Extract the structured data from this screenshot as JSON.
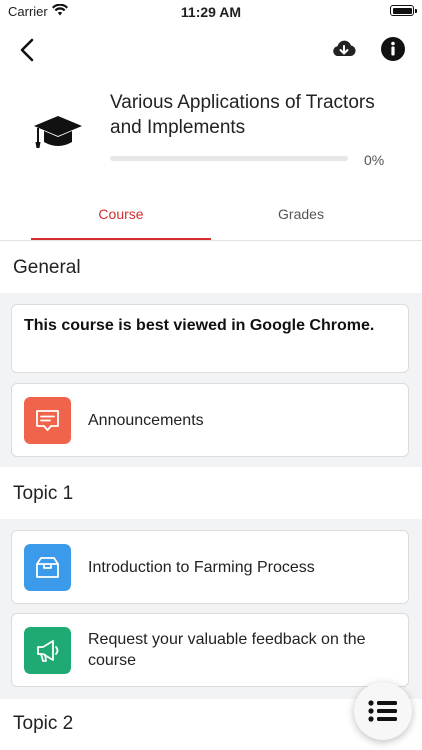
{
  "status_bar": {
    "carrier": "Carrier",
    "time": "11:29 AM"
  },
  "course": {
    "title": "Various Applications of Tractors and Implements",
    "progress_fraction": 0.0,
    "progress_label": "0%"
  },
  "tabs": [
    {
      "label": "Course",
      "active": true
    },
    {
      "label": "Grades",
      "active": false
    }
  ],
  "sections": [
    {
      "title": "General",
      "notice": "This course is best viewed in Google Chrome.",
      "items": [
        {
          "label": "Announcements",
          "icon": "announcement-icon",
          "color": "#f0644b"
        }
      ]
    },
    {
      "title": "Topic 1",
      "items": [
        {
          "label": "Introduction to Farming Process",
          "icon": "box-icon",
          "color": "#3b9bea"
        },
        {
          "label": "Request your valuable feedback on the course",
          "icon": "megaphone-icon",
          "color": "#1eaa72"
        }
      ]
    },
    {
      "title": "Topic 2",
      "items": []
    }
  ],
  "colors": {
    "accent": "#d32f2f"
  }
}
